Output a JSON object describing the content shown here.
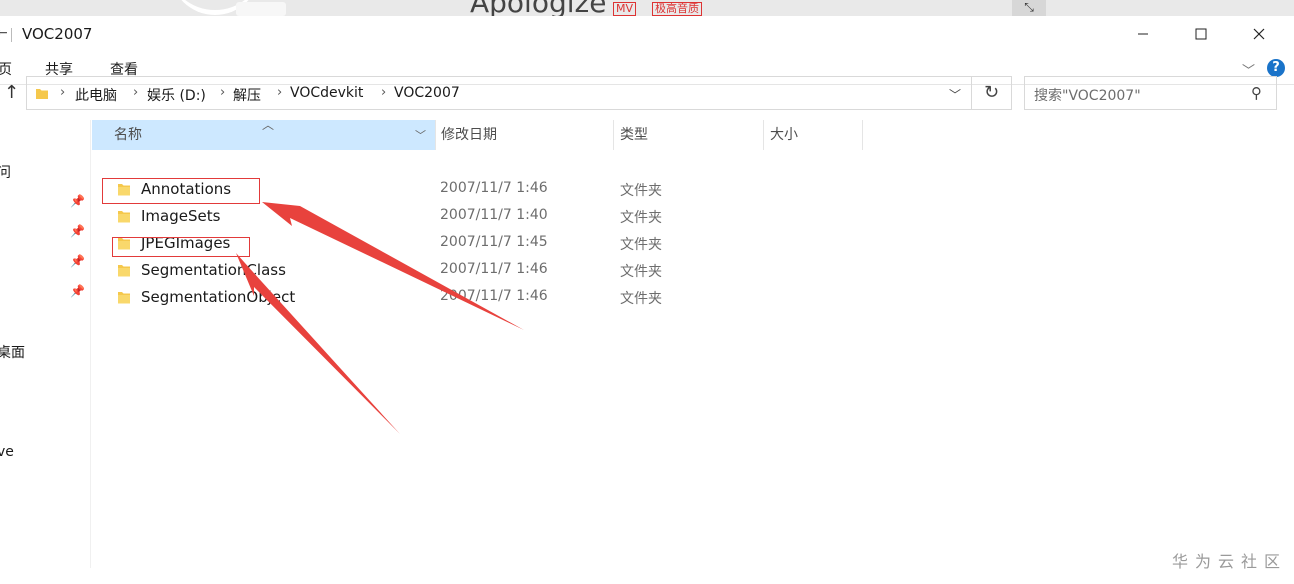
{
  "background_app": {
    "title": "Apologize",
    "mv_badge": "MV",
    "tag": "极高音质"
  },
  "window": {
    "title": "VOC2007"
  },
  "ribbon": {
    "tabs": [
      "页",
      "共享",
      "查看"
    ]
  },
  "address": {
    "crumbs": [
      "此电脑",
      "娱乐 (D:)",
      "解压",
      "VOCdevkit",
      "VOC2007"
    ],
    "search_placeholder": "搜索\"VOC2007\""
  },
  "nav": {
    "fragments": [
      "问",
      "桌面",
      "ve"
    ]
  },
  "columns": {
    "name": "名称",
    "date": "修改日期",
    "type": "类型",
    "size": "大小"
  },
  "files": [
    {
      "name": "Annotations",
      "date": "2007/11/7 1:46",
      "type": "文件夹"
    },
    {
      "name": "ImageSets",
      "date": "2007/11/7 1:40",
      "type": "文件夹"
    },
    {
      "name": "JPEGImages",
      "date": "2007/11/7 1:45",
      "type": "文件夹"
    },
    {
      "name": "SegmentationClass",
      "date": "2007/11/7 1:46",
      "type": "文件夹"
    },
    {
      "name": "SegmentationObject",
      "date": "2007/11/7 1:46",
      "type": "文件夹"
    }
  ],
  "colors": {
    "header_selected": "#cde8ff",
    "annotation_red": "#e23a3a",
    "folder_yellow": "#f5c84c"
  },
  "watermark": "华为云社区"
}
